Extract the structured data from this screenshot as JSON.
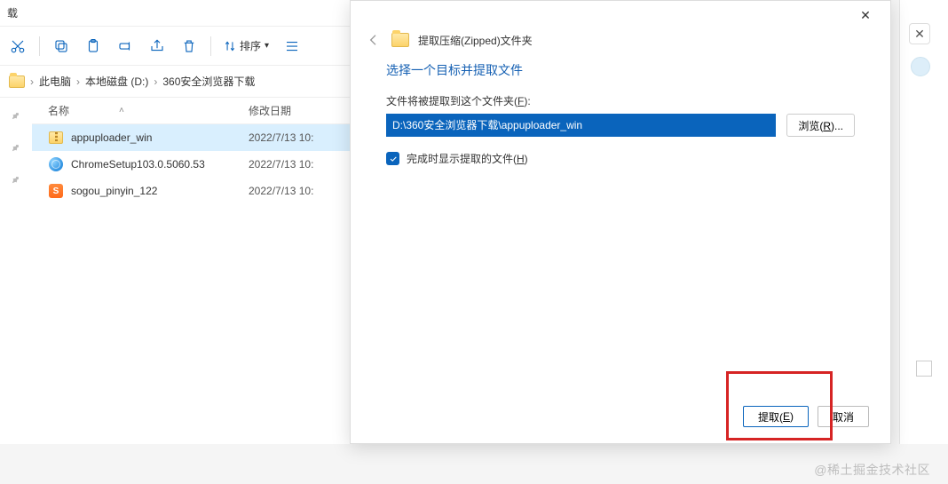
{
  "explorer": {
    "window_title": "载",
    "sort_label": "排序",
    "breadcrumb": [
      "此电脑",
      "本地磁盘 (D:)",
      "360安全浏览器下载"
    ],
    "columns": {
      "name": "名称",
      "date": "修改日期"
    },
    "files": [
      {
        "name": "appuploader_win",
        "date": "2022/7/13 10:",
        "icon": "zip",
        "selected": true
      },
      {
        "name": "ChromeSetup103.0.5060.53",
        "date": "2022/7/13 10:",
        "icon": "exe",
        "selected": false
      },
      {
        "name": "sogou_pinyin_122",
        "date": "2022/7/13 10:",
        "icon": "sogou",
        "selected": false
      }
    ]
  },
  "dialog": {
    "title": "提取压缩(Zipped)文件夹",
    "heading": "选择一个目标并提取文件",
    "path_label_prefix": "文件将被提取到这个文件夹(",
    "path_hotkey": "F",
    "path_label_suffix": "):",
    "path_value": "D:\\360安全浏览器下载\\appuploader_win",
    "browse_prefix": "浏览(",
    "browse_hotkey": "R",
    "browse_suffix": ")...",
    "show_files_prefix": "完成时显示提取的文件(",
    "show_files_hotkey": "H",
    "show_files_suffix": ")",
    "show_files_checked": true,
    "extract_prefix": "提取(",
    "extract_hotkey": "E",
    "extract_suffix": ")",
    "cancel": "取消"
  },
  "watermark": "@稀土掘金技术社区"
}
